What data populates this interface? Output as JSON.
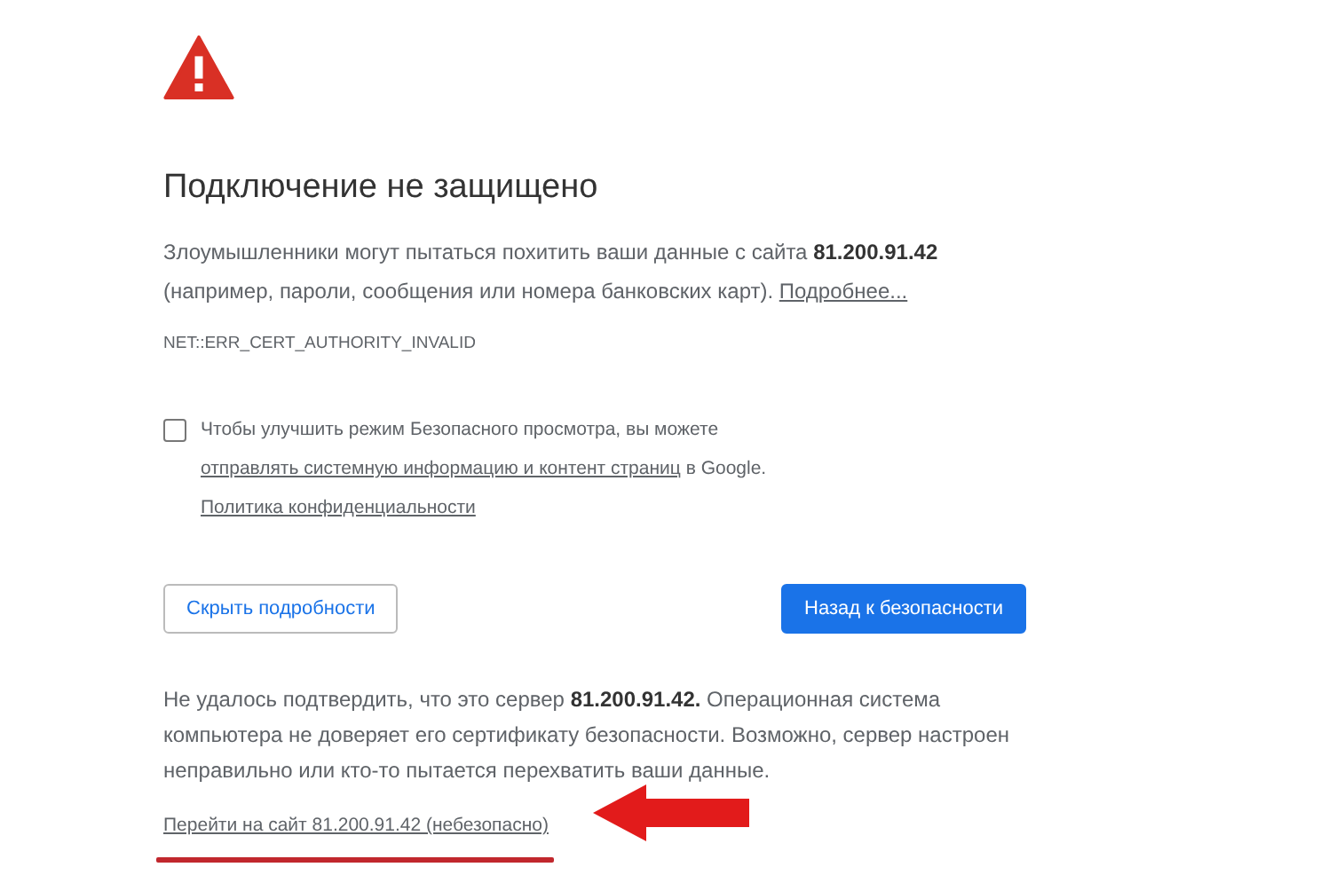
{
  "title": "Подключение не защищено",
  "summary": {
    "text": "Злоумышленники могут пытаться похитить ваши данные с сайта **81.200.91.42** (например, пароли, сообщения или номера банковских карт). ",
    "link": "Подробнее..."
  },
  "error_code": "NET::ERR_CERT_AUTHORITY_INVALID",
  "consent": {
    "checked": false,
    "segments": [
      {
        "kind": "text",
        "text": "Чтобы улучшить режим Безопасного просмотра, вы можете "
      },
      {
        "kind": "link",
        "text": "отправлять системную информацию и контент страниц"
      },
      {
        "kind": "text",
        "text": " в Google. "
      },
      {
        "kind": "link",
        "text": "Политика конфиденциальности"
      }
    ]
  },
  "buttons": [
    {
      "label": "Скрыть подробности",
      "kind": "secondary"
    },
    {
      "label": "Назад к безопасности",
      "kind": "primary"
    }
  ],
  "details": "Не удалось подтвердить, что это сервер **81.200.91.42.** Операционная система компьютера не доверяет его сертификату безопасности. Возможно, сервер настроен неправильно или кто-то пытается перехватить ваши данные.",
  "proceed_link": "Перейти на сайт 81.200.91.42 (небезопасно)"
}
